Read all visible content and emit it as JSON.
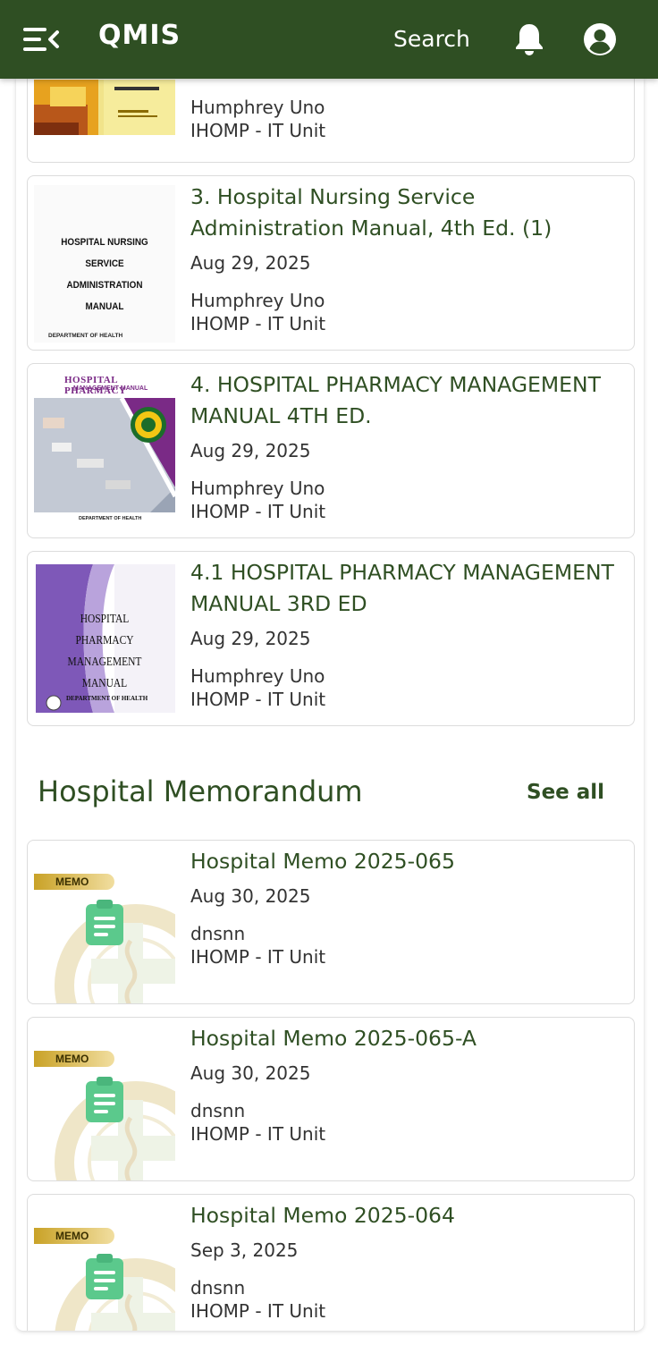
{
  "app": {
    "title": "QMIS",
    "search_label": "Search"
  },
  "manuals": [
    {
      "title": "",
      "date": "",
      "author": "Humphrey Uno",
      "unit": "IHOMP - IT Unit",
      "cover_text": ""
    },
    {
      "title": "3. Hospital Nursing Service Administration Manual, 4th Ed. (1)",
      "date": "Aug 29, 2025",
      "author": "Humphrey Uno",
      "unit": "IHOMP - IT Unit",
      "cover_text": "HOSPITAL NURSING SERVICE ADMINISTRATION MANUAL",
      "cover_footer": "DEPARTMENT OF HEALTH"
    },
    {
      "title": "4. HOSPITAL PHARMACY MANAGEMENT MANUAL 4TH ED.",
      "date": "Aug 29, 2025",
      "author": "Humphrey Uno",
      "unit": "IHOMP - IT Unit",
      "cover_text": "HOSPITAL PHARMACY",
      "cover_subtext": "MANAGEMENT MANUAL",
      "cover_footer": "DEPARTMENT OF HEALTH"
    },
    {
      "title": "4.1 HOSPITAL PHARMACY MANAGEMENT MANUAL 3RD ED",
      "date": "Aug 29, 2025",
      "author": "Humphrey Uno",
      "unit": "IHOMP - IT Unit",
      "cover_text": "HOSPITAL PHARMACY MANAGEMENT MANUAL",
      "cover_footer": "DEPARTMENT OF HEALTH"
    }
  ],
  "memo_section": {
    "title": "Hospital Memorandum",
    "see_all": "See all"
  },
  "memos": [
    {
      "badge": "MEMO",
      "title": "Hospital Memo 2025-065",
      "date": "Aug 30, 2025",
      "author": "dnsnn",
      "unit": "IHOMP - IT Unit"
    },
    {
      "badge": "MEMO",
      "title": "Hospital Memo 2025-065-A",
      "date": "Aug 30, 2025",
      "author": "dnsnn",
      "unit": "IHOMP - IT Unit"
    },
    {
      "badge": "MEMO",
      "title": "Hospital Memo 2025-064",
      "date": "Sep 3, 2025",
      "author": "dnsnn",
      "unit": "IHOMP - IT Unit"
    }
  ],
  "colors": {
    "brand": "#2f4f23",
    "memo_badge": "#c9a227",
    "memo_icon": "#5bc98c"
  }
}
